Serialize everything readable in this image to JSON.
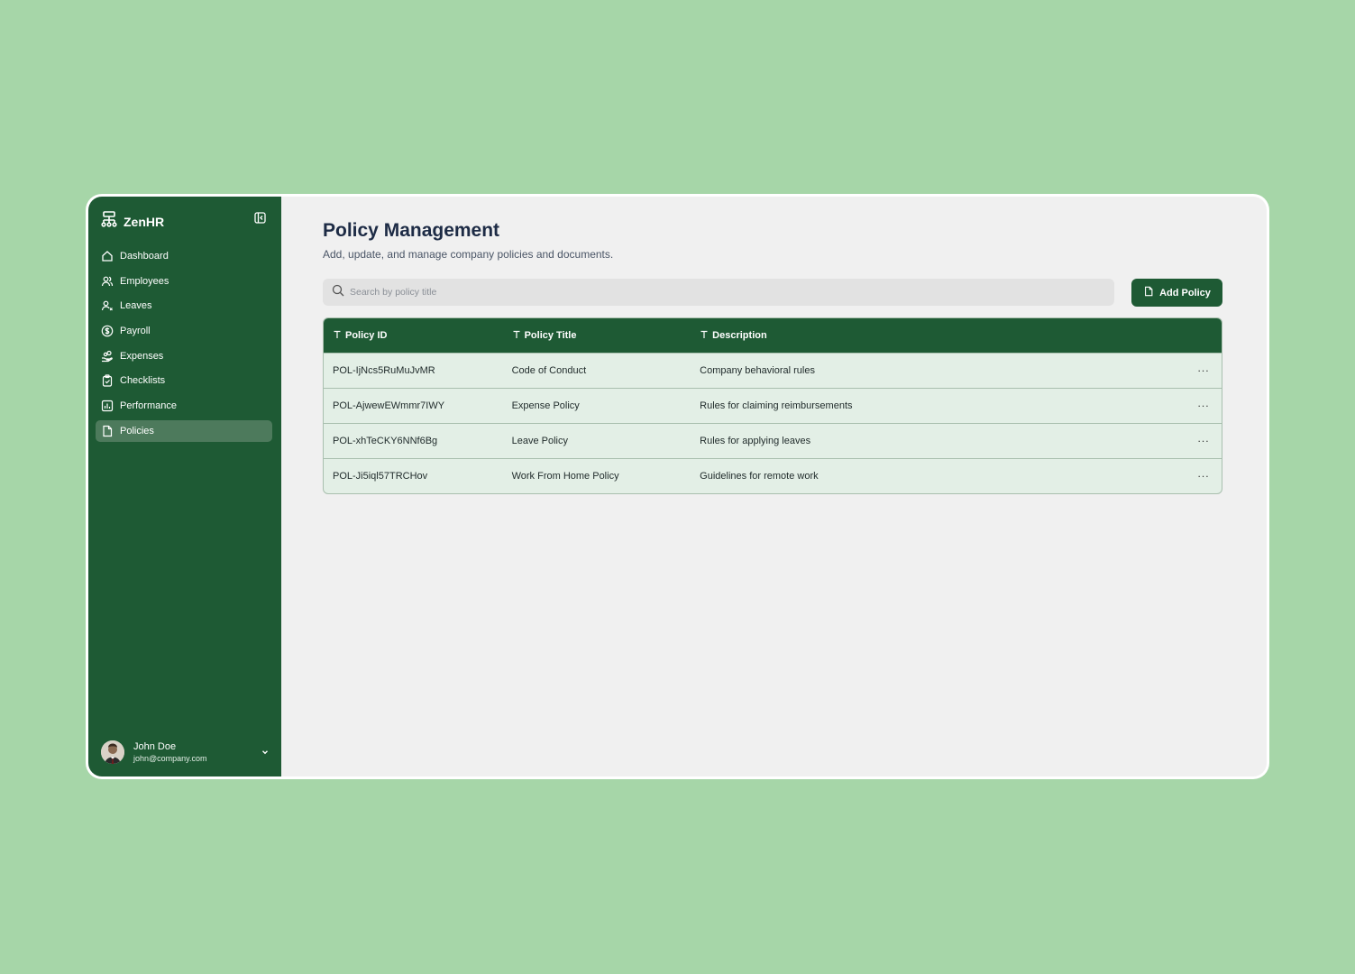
{
  "app": {
    "brand": "ZenHR"
  },
  "sidebar": {
    "items": [
      {
        "label": "Dashboard",
        "icon": "home-icon"
      },
      {
        "label": "Employees",
        "icon": "users-icon"
      },
      {
        "label": "Leaves",
        "icon": "user-x-icon"
      },
      {
        "label": "Payroll",
        "icon": "dollar-circle-icon"
      },
      {
        "label": "Expenses",
        "icon": "hand-coins-icon"
      },
      {
        "label": "Checklists",
        "icon": "clipboard-check-icon"
      },
      {
        "label": "Performance",
        "icon": "bar-chart-icon"
      },
      {
        "label": "Policies",
        "icon": "file-icon",
        "active": true
      }
    ]
  },
  "user": {
    "name": "John Doe",
    "email": "john@company.com"
  },
  "header": {
    "title": "Policy Management",
    "subtitle": "Add, update, and manage company policies and documents."
  },
  "search": {
    "placeholder": "Search by policy title",
    "value": ""
  },
  "toolbar": {
    "add_label": "Add Policy"
  },
  "table": {
    "columns": [
      "Policy ID",
      "Policy Title",
      "Description"
    ],
    "rows": [
      [
        "POL-IjNcs5RuMuJvMR",
        "Code of Conduct",
        "Company behavioral rules"
      ],
      [
        "POL-AjwewEWmmr7IWY",
        "Expense Policy",
        "Rules for claiming reimbursements"
      ],
      [
        "POL-xhTeCKY6NNf6Bg",
        "Leave Policy",
        "Rules for applying leaves"
      ],
      [
        "POL-Ji5iql57TRCHov",
        "Work From Home Policy",
        "Guidelines for remote work"
      ]
    ],
    "row_action": "..."
  },
  "colors": {
    "brand": "#1e5a34",
    "background": "#a6d6a8",
    "active_nav": "#4d7a5c",
    "row_bg": "#e3efe6"
  }
}
